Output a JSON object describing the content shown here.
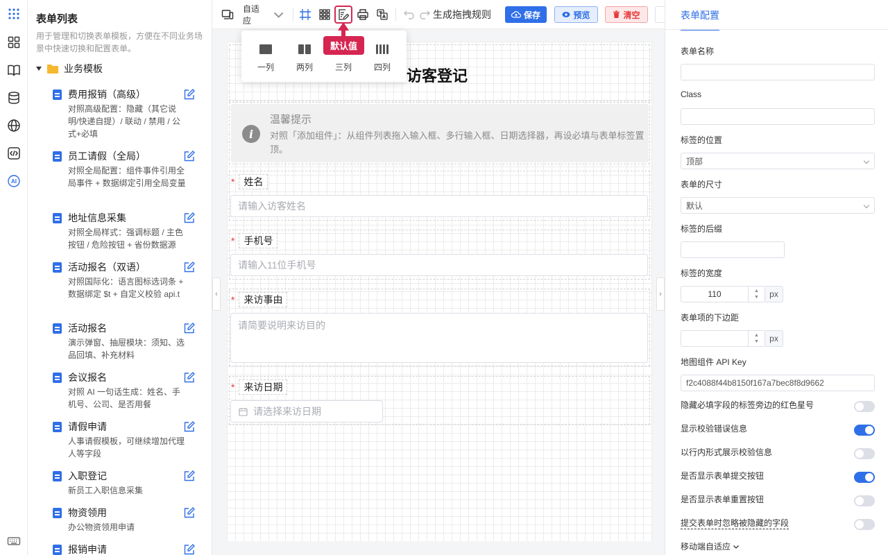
{
  "rail": {
    "icons": [
      "apps-grid-icon",
      "layout-grid-icon",
      "book-icon",
      "database-icon",
      "globe-icon",
      "code-icon",
      "ai-icon",
      "keyboard-icon"
    ],
    "ai_label": "AI"
  },
  "sidebar": {
    "title": "表单列表",
    "desc": "用于管理和切换表单模板，方便在不同业务场景中快速切换和配置表单。",
    "folder": "业务模板",
    "templates": [
      {
        "title": "费用报销（高级）",
        "desc": "对照高级配置：隐藏（其它说明/快递自提）/ 联动 / 禁用 / 公式+必填"
      },
      {
        "title": "员工请假（全局）",
        "desc": "对照全局配置：组件事件引用全局事件 + 数据绑定引用全局变量"
      },
      {
        "title": "地址信息采集",
        "desc": "对照全局样式：强调标题 / 主色按钮 / 危险按钮 + 省份数据源"
      },
      {
        "title": "活动报名（双语）",
        "desc": "对照国际化：语言图标选词条 + 数据绑定 $t + 自定义校验 api.t"
      },
      {
        "title": "活动报名",
        "desc": "演示弹窗、抽屉模块：须知、选品回填、补充材料"
      },
      {
        "title": "会议报名",
        "desc": "对照 AI 一句话生成：姓名、手机号、公司、是否用餐"
      },
      {
        "title": "请假申请",
        "desc": "人事请假模板，可继续增加代理人等字段"
      },
      {
        "title": "入职登记",
        "desc": "新员工入职信息采集"
      },
      {
        "title": "物资领用",
        "desc": "办公物资领用申请"
      },
      {
        "title": "报销申请",
        "desc": ""
      }
    ]
  },
  "toolbar": {
    "adaptive_label": "自适应",
    "generate_rules": "生成拖拽规则",
    "save": "保存",
    "preview": "预览",
    "clear": "清空",
    "tooltip": "默认值"
  },
  "layout_popover": {
    "items": [
      "一列",
      "两列",
      "三列",
      "四列"
    ]
  },
  "form": {
    "title": "访客登记",
    "alert_title": "温馨提示",
    "alert_body": "对照「添加组件」：从组件列表拖入输入框、多行输入框、日期选择器，再设必填与表单标签置顶。",
    "fields": [
      {
        "label": "姓名",
        "placeholder": "请输入访客姓名",
        "required": true
      },
      {
        "label": "手机号",
        "placeholder": "请输入11位手机号",
        "required": true
      },
      {
        "label": "来访事由",
        "placeholder": "请简要说明来访目的",
        "required": true
      },
      {
        "label": "来访日期",
        "placeholder": "请选择来访日期",
        "required": true
      }
    ]
  },
  "config": {
    "tab": "表单配置",
    "form_name_label": "表单名称",
    "form_name_value": "",
    "class_label": "Class",
    "class_value": "",
    "label_position_label": "标签的位置",
    "label_position_value": "顶部",
    "form_size_label": "表单的尺寸",
    "form_size_value": "默认",
    "label_suffix_label": "标签的后缀",
    "label_suffix_value": "",
    "label_width_label": "标签的宽度",
    "label_width_value": "110",
    "unit": "px",
    "item_margin_label": "表单项的下边距",
    "item_margin_value": "",
    "map_key_label": "地图组件 API Key",
    "map_key_value": "f2c4088f44b8150f167a7bec8f8d9662",
    "toggles": [
      {
        "label": "隐藏必填字段的标签旁边的红色星号",
        "on": false
      },
      {
        "label": "显示校验错误信息",
        "on": true
      },
      {
        "label": "以行内形式展示校验信息",
        "on": false
      },
      {
        "label": "是否显示表单提交按钮",
        "on": true
      },
      {
        "label": "是否显示表单重置按钮",
        "on": false
      },
      {
        "label": "提交表单时忽略被隐藏的字段",
        "on": false
      }
    ],
    "mobile_label": "移动端自适应"
  },
  "colors": {
    "primary": "#2f6fe8",
    "danger": "#e5383b",
    "tooltip": "#d52651"
  }
}
